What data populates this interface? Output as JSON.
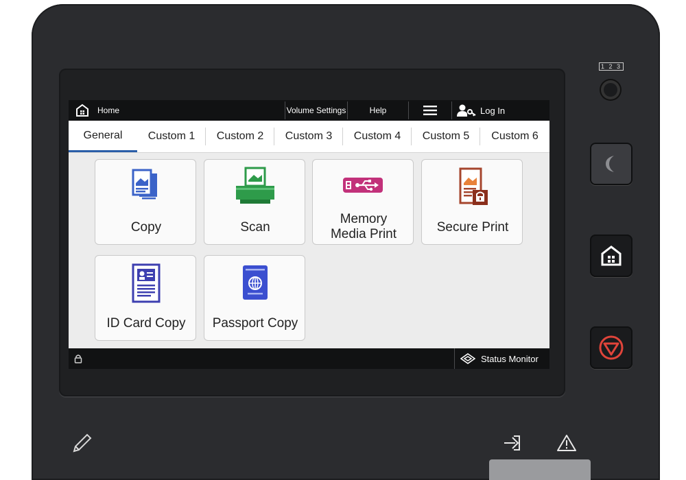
{
  "topbar": {
    "home_label": "Home",
    "volume_label": "Volume Settings",
    "help_label": "Help",
    "login_label": "Log In"
  },
  "tabs": [
    {
      "label": "General",
      "active": true
    },
    {
      "label": "Custom 1"
    },
    {
      "label": "Custom 2"
    },
    {
      "label": "Custom 3"
    },
    {
      "label": "Custom 4"
    },
    {
      "label": "Custom 5"
    },
    {
      "label": "Custom 6"
    }
  ],
  "tiles": [
    {
      "label": "Copy",
      "icon": "copy-icon"
    },
    {
      "label": "Scan",
      "icon": "scan-icon"
    },
    {
      "label_line1": "Memory",
      "label_line2": "Media Print",
      "icon": "usb-memory-icon"
    },
    {
      "label": "Secure Print",
      "icon": "secure-print-icon"
    },
    {
      "label": "ID Card Copy",
      "icon": "id-card-icon"
    },
    {
      "label": "Passport Copy",
      "icon": "passport-icon"
    }
  ],
  "bottombar": {
    "status_label": "Status Monitor"
  },
  "hardware": {
    "number_tag": "1 2 3"
  },
  "colors": {
    "tab_active": "#2a5ea8",
    "stop_button": "#e0443a",
    "icon_blue": "#3b63c8",
    "icon_green": "#2e9b4a",
    "icon_magenta": "#c2317a",
    "icon_brown": "#a5452d"
  }
}
